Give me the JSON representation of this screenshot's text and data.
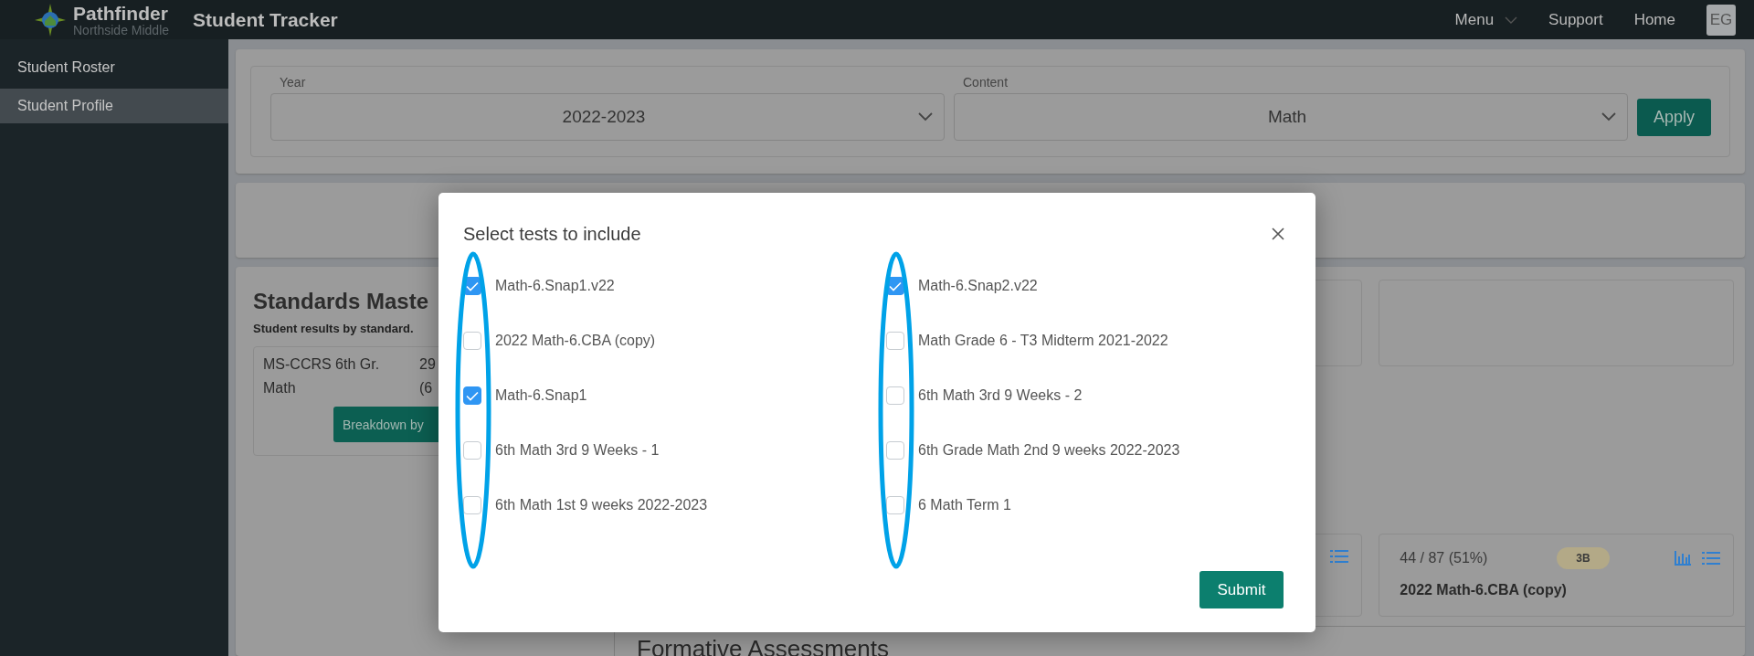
{
  "header": {
    "brand": "Pathfinder",
    "school": "Northside Middle",
    "app_title": "Student Tracker",
    "nav": [
      {
        "label": "Menu",
        "kind": "dropdown"
      },
      {
        "label": "Support",
        "kind": "link"
      },
      {
        "label": "Home",
        "kind": "link"
      }
    ],
    "avatar": "EG"
  },
  "sidebar": {
    "items": [
      {
        "label": "Student Roster",
        "selected": false
      },
      {
        "label": "Student Profile",
        "selected": true
      }
    ]
  },
  "filters": {
    "fields": [
      {
        "label": "Year",
        "value": "2022-2023"
      },
      {
        "label": "Content",
        "value": "Math"
      }
    ],
    "apply_button": "Apply"
  },
  "standards_panel": {
    "title": "Standards Maste",
    "subtitle": "Student results by standard.",
    "standard_name": [
      "MS-CCRS 6th Gr.",
      "Math"
    ],
    "standard_score": [
      "29",
      "(6"
    ],
    "button": "Breakdown by"
  },
  "assessment_cards": [
    {
      "kind": "icons_only"
    },
    {
      "kind": "full",
      "score": "44 / 87 (51%)",
      "badge": "3B",
      "title": "2022 Math-6.CBA (copy)"
    }
  ],
  "formative_heading": "Formative Assessments",
  "modal": {
    "title": "Select tests to include",
    "columns": [
      {
        "circled": true,
        "tests": [
          {
            "label": "Math-6.Snap1.v22",
            "checked": true
          },
          {
            "label": "2022 Math-6.CBA (copy)",
            "checked": false
          },
          {
            "label": "Math-6.Snap1",
            "checked": true
          },
          {
            "label": "6th Math 3rd 9 Weeks - 1",
            "checked": false
          },
          {
            "label": "6th Math 1st 9 weeks 2022-2023",
            "checked": false
          }
        ]
      },
      {
        "circled": true,
        "tests": [
          {
            "label": "Math-6.Snap2.v22",
            "checked": true
          },
          {
            "label": "Math Grade 6 - T3 Midterm 2021-2022",
            "checked": false
          },
          {
            "label": "6th Math 3rd 9 Weeks - 2",
            "checked": false
          },
          {
            "label": "6th Grade Math 2nd 9 weeks 2022-2023",
            "checked": false
          },
          {
            "label": "6 Math  Term 1",
            "checked": false
          }
        ]
      }
    ],
    "submit": "Submit"
  }
}
